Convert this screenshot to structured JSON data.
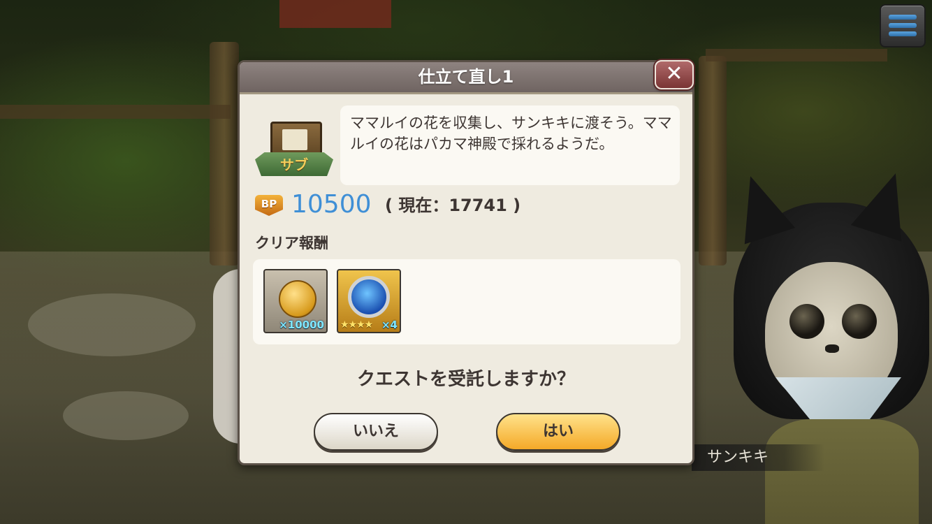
{
  "dialog": {
    "title": "仕立て直し1",
    "close_label": "✕",
    "badge_label": "サブ",
    "description": "ママルイの花を収集し、サンキキに渡そう。ママルイの花はパカマ神殿で採れるようだ。",
    "bp": {
      "icon_label": "BP",
      "value": "10500",
      "current": "( 現在：17741 )"
    },
    "rewards_heading": "クリア報酬",
    "rewards": [
      {
        "icon": "coin-icon",
        "quantity": "×10000"
      },
      {
        "icon": "orb-icon",
        "stars": "★★★★",
        "quantity": "×4"
      }
    ],
    "confirm_text": "クエストを受託しますか？",
    "buttons": {
      "no": "いいえ",
      "yes": "はい"
    }
  },
  "npc": {
    "name": "サンキキ"
  },
  "menu": {
    "icon": "hamburger-menu-icon"
  },
  "colors": {
    "bp_value": "#3f8fd6",
    "yes_button": "#f4a928",
    "dialog_bg": "#efebe0",
    "header_bg": "#7f7471"
  }
}
